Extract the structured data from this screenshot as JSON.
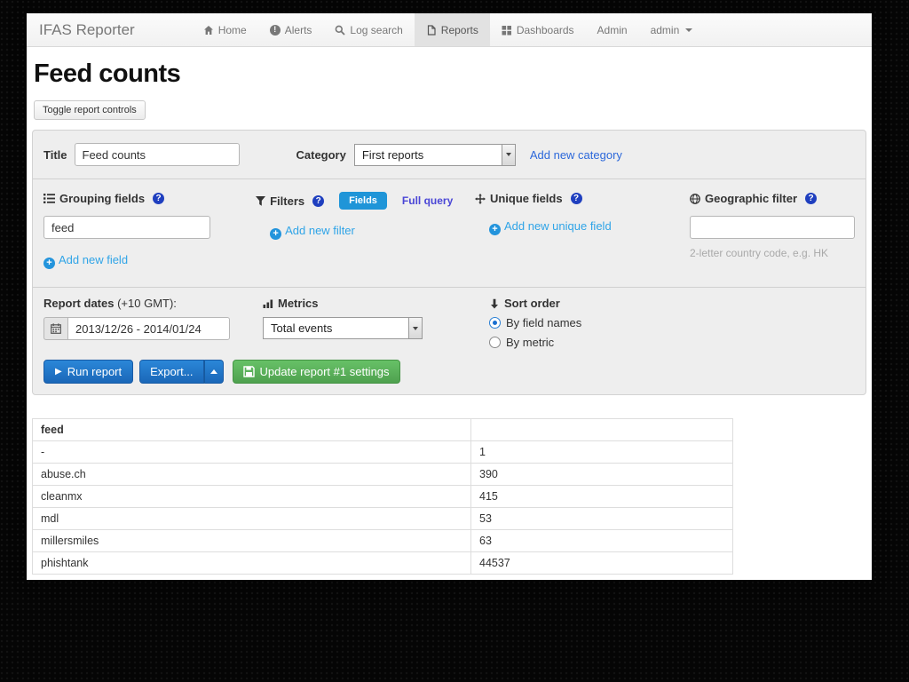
{
  "navbar": {
    "brand": "IFAS Reporter",
    "items": [
      {
        "label": "Home"
      },
      {
        "label": "Alerts"
      },
      {
        "label": "Log search"
      },
      {
        "label": "Reports"
      },
      {
        "label": "Dashboards"
      },
      {
        "label": "Admin"
      },
      {
        "label": "admin"
      }
    ]
  },
  "page": {
    "title": "Feed counts",
    "toggle_button": "Toggle report controls"
  },
  "report_controls": {
    "title_label": "Title",
    "title_value": "Feed counts",
    "category_label": "Category",
    "category_value": "First reports",
    "add_category_link": "Add new category",
    "grouping": {
      "label": "Grouping fields",
      "field_value": "feed",
      "add_link": "Add new field"
    },
    "filters": {
      "label": "Filters",
      "fields_button": "Fields",
      "full_query_link": "Full query",
      "add_link": "Add new filter"
    },
    "unique": {
      "label": "Unique fields",
      "add_link": "Add new unique field"
    },
    "geo": {
      "label": "Geographic filter",
      "value": "",
      "help_text": "2-letter country code, e.g. HK"
    },
    "dates": {
      "label": "Report dates",
      "tz_suffix": "(+10 GMT):",
      "value": "2013/12/26 - 2014/01/24"
    },
    "metrics": {
      "label": "Metrics",
      "value": "Total events"
    },
    "sort": {
      "label": "Sort order",
      "options": [
        {
          "label": "By field names",
          "selected": true
        },
        {
          "label": "By metric",
          "selected": false
        }
      ]
    },
    "buttons": {
      "run": "Run report",
      "export": "Export...",
      "update": "Update report #1 settings"
    }
  },
  "results_table": {
    "columns": [
      "feed",
      ""
    ],
    "rows": [
      [
        "-",
        "1"
      ],
      [
        "abuse.ch",
        "390"
      ],
      [
        "cleanmx",
        "415"
      ],
      [
        "mdl",
        "53"
      ],
      [
        "millersmiles",
        "63"
      ],
      [
        "phishtank",
        "44537"
      ]
    ]
  },
  "icons": {
    "plus": "+",
    "help": "?",
    "alert": "!",
    "play": "▶"
  },
  "colors": {
    "accent_blue": "#2fa4e7",
    "button_blue": "#1a67b8",
    "button_green": "#4fa14f",
    "help_badge_blue": "#1f3fbf",
    "panel_gray": "#eeeeee"
  }
}
